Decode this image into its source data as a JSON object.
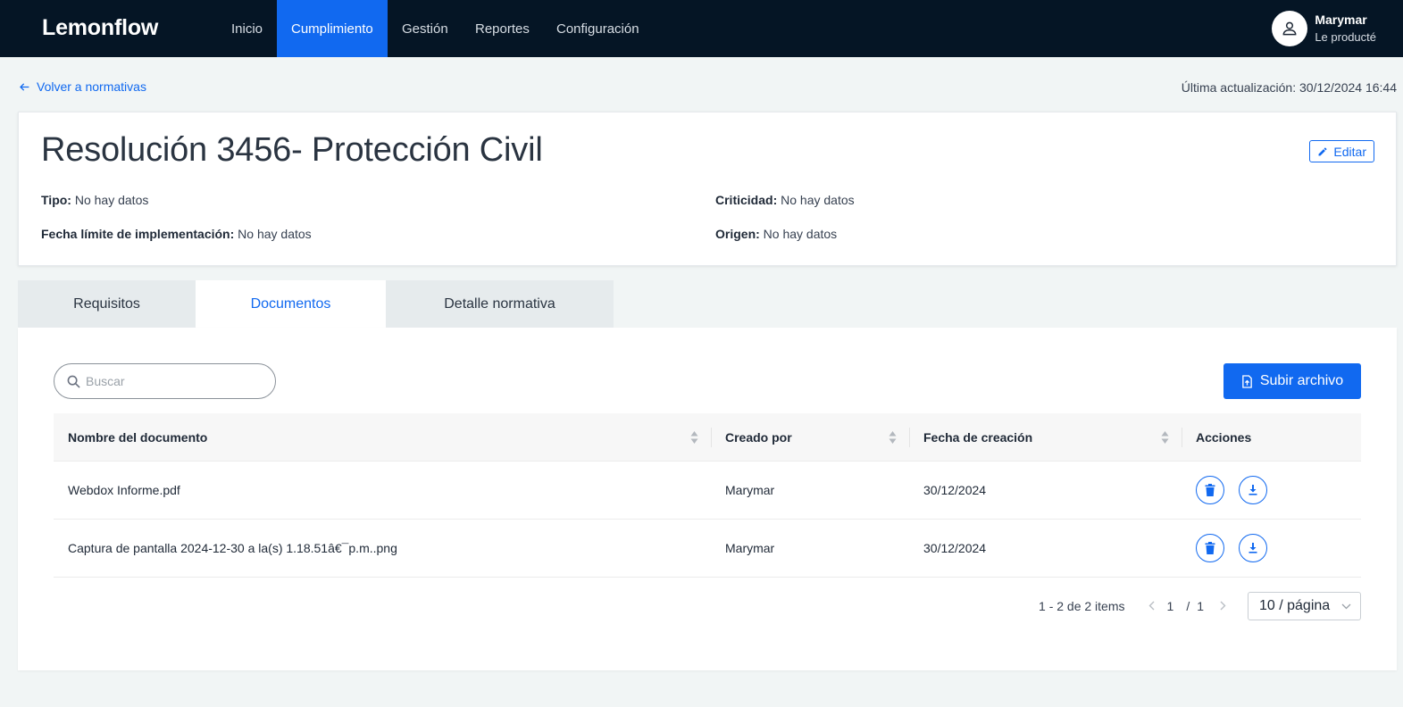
{
  "app": {
    "brand": "Lemonflow"
  },
  "nav": {
    "items": [
      {
        "label": "Inicio",
        "active": false
      },
      {
        "label": "Cumplimiento",
        "active": true
      },
      {
        "label": "Gestión",
        "active": false
      },
      {
        "label": "Reportes",
        "active": false
      },
      {
        "label": "Configuración",
        "active": false
      }
    ]
  },
  "user": {
    "name": "Marymar",
    "company": "Le producté",
    "icon": "user-icon"
  },
  "back_link": {
    "label": "Volver a normativas",
    "icon": "arrow-left-icon"
  },
  "last_update": "Última actualización: 30/12/2024 16:44",
  "regulation": {
    "title": "Resolución 3456- Protección Civil",
    "edit_label": "Editar",
    "fields": {
      "tipo": {
        "label": "Tipo:",
        "value": "No hay datos"
      },
      "criticidad": {
        "label": "Criticidad:",
        "value": "No hay datos"
      },
      "fecha_limite": {
        "label": "Fecha límite de implementación:",
        "value": "No hay datos"
      },
      "origen": {
        "label": "Origen:",
        "value": "No hay datos"
      }
    }
  },
  "tabs": [
    {
      "label": "Requisitos",
      "active": false
    },
    {
      "label": "Documentos",
      "active": true
    },
    {
      "label": "Detalle normativa",
      "active": false
    }
  ],
  "documents": {
    "search_placeholder": "Buscar",
    "upload_label": "Subir archivo",
    "columns": [
      "Nombre del documento",
      "Creado por",
      "Fecha de creación",
      "Acciones"
    ],
    "rows": [
      {
        "name": "Webdox Informe.pdf",
        "created_by": "Marymar",
        "created_at": "30/12/2024"
      },
      {
        "name": "Captura de pantalla 2024-12-30 a la(s) 1.18.51â€¯p.m..png",
        "created_by": "Marymar",
        "created_at": "30/12/2024"
      }
    ],
    "pagination": {
      "total_text": "1 - 2 de 2 items",
      "current_page": "1",
      "separator": "/",
      "total_pages": "1",
      "page_size": "10 / página"
    }
  },
  "colors": {
    "topbar": "#051525",
    "accent": "#1169f0",
    "background": "#f1f5f5"
  }
}
